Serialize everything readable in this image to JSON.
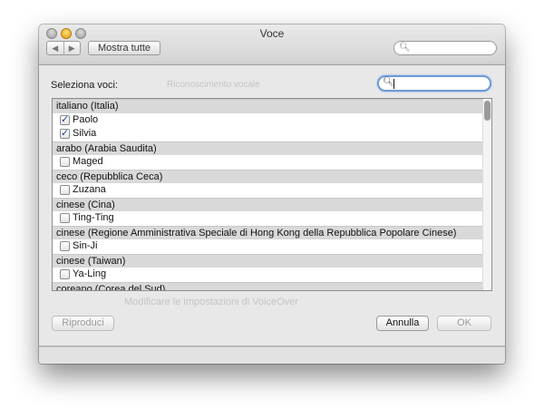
{
  "window": {
    "title": "Voce",
    "nav_back": "◀",
    "nav_forward": "▶",
    "show_all": "Mostra tutte",
    "search_placeholder": ""
  },
  "sheet": {
    "label": "Seleziona voci:",
    "search_value": "",
    "ghost_texts": [
      "Riconoscimento vocale",
      "Modificare le impostazioni di VoiceOver"
    ],
    "groups": [
      {
        "name": "italiano (Italia)",
        "voices": [
          {
            "name": "Paolo",
            "checked": true
          },
          {
            "name": "Silvia",
            "checked": true
          }
        ]
      },
      {
        "name": "arabo (Arabia Saudita)",
        "voices": [
          {
            "name": "Maged",
            "checked": false
          }
        ]
      },
      {
        "name": "ceco (Repubblica Ceca)",
        "voices": [
          {
            "name": "Zuzana",
            "checked": false
          }
        ]
      },
      {
        "name": "cinese (Cina)",
        "voices": [
          {
            "name": "Ting-Ting",
            "checked": false
          }
        ]
      },
      {
        "name": "cinese (Regione Amministrativa Speciale di Hong Kong della Repubblica Popolare Cinese)",
        "voices": [
          {
            "name": "Sin-Ji",
            "checked": false
          }
        ]
      },
      {
        "name": "cinese (Taiwan)",
        "voices": [
          {
            "name": "Ya-Ling",
            "checked": false
          }
        ]
      },
      {
        "name": "coreano (Corea del Sud)",
        "voices": []
      }
    ],
    "buttons": {
      "play": "Riproduci",
      "cancel": "Annulla",
      "ok": "OK"
    }
  },
  "colors": {
    "focus_ring": "#6f9ad8",
    "checkmark": "#1d3e86",
    "group_header_bg": "#d9d9d9"
  }
}
